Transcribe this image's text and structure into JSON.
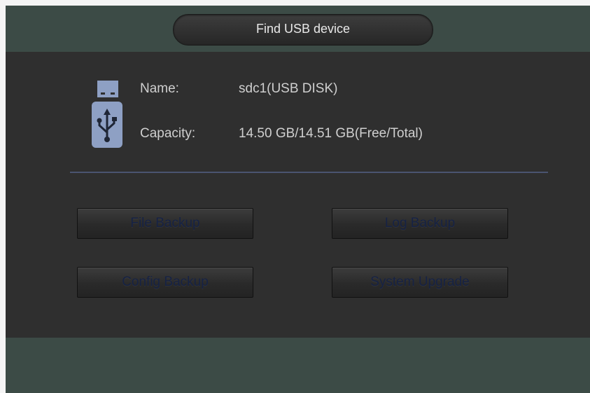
{
  "dialog": {
    "title": "Find USB device"
  },
  "device": {
    "icon": "usb-drive-icon",
    "name_label": "Name:",
    "name_value": "sdc1(USB DISK)",
    "capacity_label": "Capacity:",
    "capacity_value": "14.50 GB/14.51 GB(Free/Total)"
  },
  "actions": {
    "file_backup": "File Backup",
    "log_backup": "Log Backup",
    "config_backup": "Config Backup",
    "system_upgrade": "System Upgrade"
  },
  "colors": {
    "title_bar": "#3c4b46",
    "panel": "#2f2f2f",
    "button_text": "#162244",
    "usb_icon": "#8ea0c4",
    "divider": "#4a5470"
  }
}
